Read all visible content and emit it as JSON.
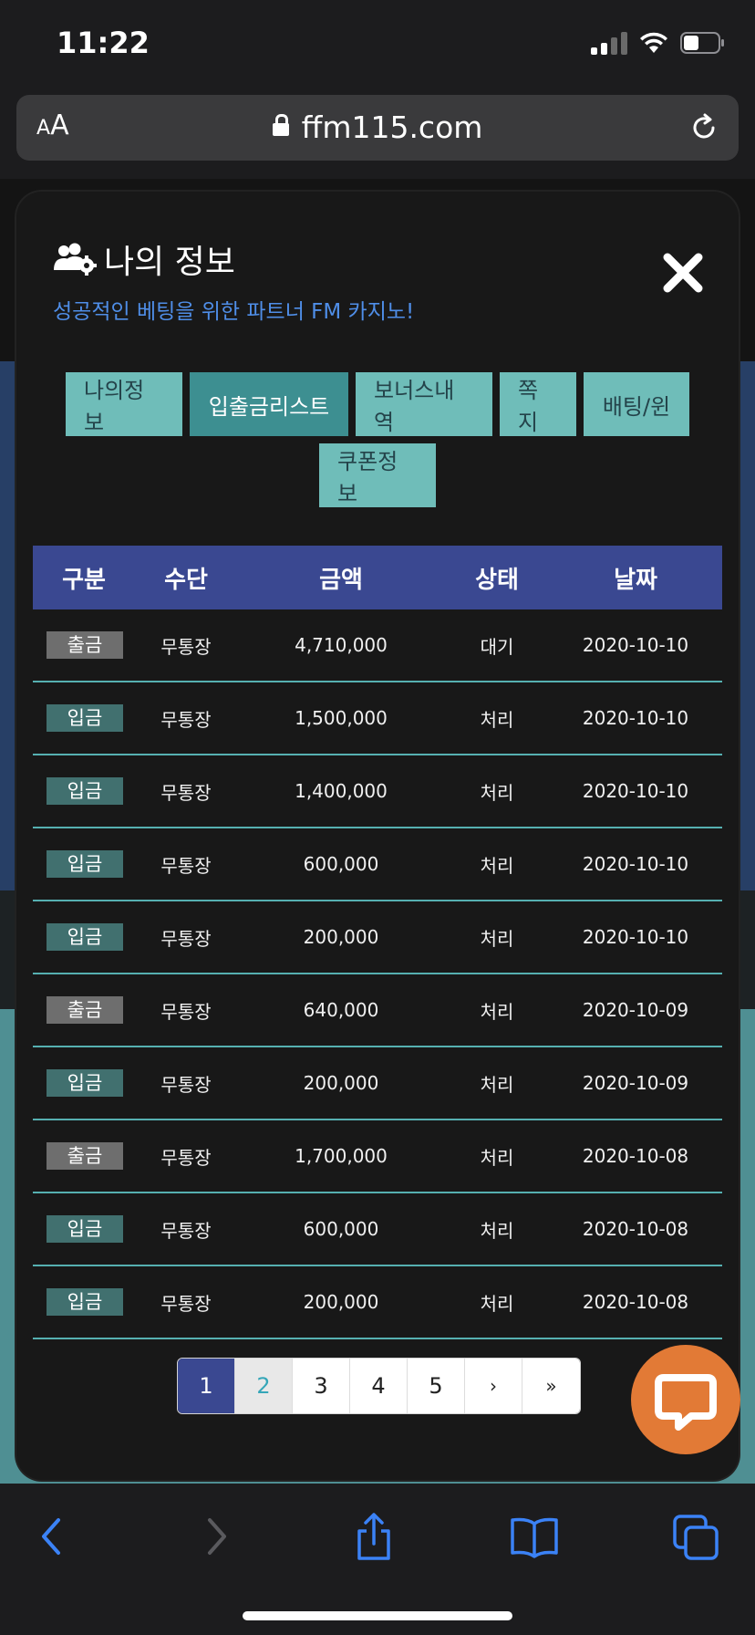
{
  "status_bar": {
    "time": "11:22"
  },
  "browser": {
    "aa_small": "A",
    "aa_large": "A",
    "url": "ffm115.com"
  },
  "modal": {
    "title": "나의 정보",
    "subtitle": "성공적인 베팅을 위한 파트너 FM 카지노!",
    "tabs": [
      {
        "label": "나의정보",
        "active": false
      },
      {
        "label": "입출금리스트",
        "active": true
      },
      {
        "label": "보너스내역",
        "active": false
      },
      {
        "label": "쪽지",
        "active": false
      },
      {
        "label": "배팅/윈",
        "active": false
      },
      {
        "label": "쿠폰정보",
        "active": false
      }
    ],
    "table": {
      "headers": [
        "구분",
        "수단",
        "금액",
        "상태",
        "날짜"
      ],
      "rows": [
        {
          "type": "출금",
          "method": "무통장",
          "amount": "4,710,000",
          "status": "대기",
          "date": "2020-10-10"
        },
        {
          "type": "입금",
          "method": "무통장",
          "amount": "1,500,000",
          "status": "처리",
          "date": "2020-10-10"
        },
        {
          "type": "입금",
          "method": "무통장",
          "amount": "1,400,000",
          "status": "처리",
          "date": "2020-10-10"
        },
        {
          "type": "입금",
          "method": "무통장",
          "amount": "600,000",
          "status": "처리",
          "date": "2020-10-10"
        },
        {
          "type": "입금",
          "method": "무통장",
          "amount": "200,000",
          "status": "처리",
          "date": "2020-10-10"
        },
        {
          "type": "출금",
          "method": "무통장",
          "amount": "640,000",
          "status": "처리",
          "date": "2020-10-09"
        },
        {
          "type": "입금",
          "method": "무통장",
          "amount": "200,000",
          "status": "처리",
          "date": "2020-10-09"
        },
        {
          "type": "출금",
          "method": "무통장",
          "amount": "1,700,000",
          "status": "처리",
          "date": "2020-10-08"
        },
        {
          "type": "입금",
          "method": "무통장",
          "amount": "600,000",
          "status": "처리",
          "date": "2020-10-08"
        },
        {
          "type": "입금",
          "method": "무통장",
          "amount": "200,000",
          "status": "처리",
          "date": "2020-10-08"
        }
      ]
    },
    "pagination": {
      "pages": [
        "1",
        "2",
        "3",
        "4",
        "5"
      ],
      "current": "1",
      "next": "›",
      "last": "»"
    }
  },
  "colors": {
    "accent_blue": "#3a4891",
    "tab_teal": "#6fbdb9",
    "tab_active": "#3d8f91",
    "subtitle_blue": "#4f8ee8",
    "chat_orange": "#e27a36",
    "row_divider": "#56b0b1"
  },
  "icons": {
    "header": "users-cog-icon",
    "close": "close-icon",
    "chat": "chat-bubble-icon",
    "toolbar": [
      "back-icon",
      "forward-icon",
      "share-icon",
      "bookmarks-icon",
      "tabs-icon"
    ]
  }
}
